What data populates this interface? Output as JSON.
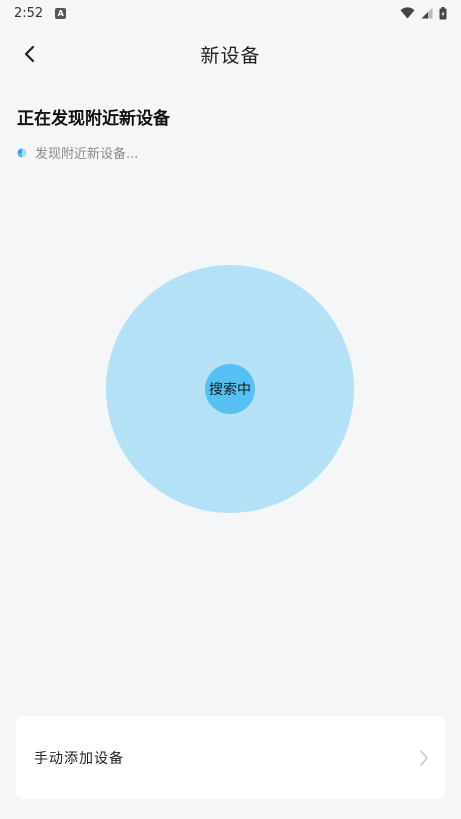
{
  "status_bar": {
    "time": "2:52",
    "notification_icon": "a-icon",
    "wifi_icon": "wifi-icon",
    "signal_icon": "signal-icon",
    "battery_icon": "battery-icon"
  },
  "header": {
    "title": "新设备",
    "back_icon": "chevron-left-icon"
  },
  "discovery": {
    "section_title": "正在发现附近新设备",
    "status_text": "发现附近新设备..."
  },
  "radar": {
    "center_label": "搜索中",
    "outer_color": "#b4e1f6",
    "inner_color": "#55c0f1"
  },
  "manual_add": {
    "label": "手动添加设备",
    "arrow_icon": "chevron-right-icon"
  }
}
